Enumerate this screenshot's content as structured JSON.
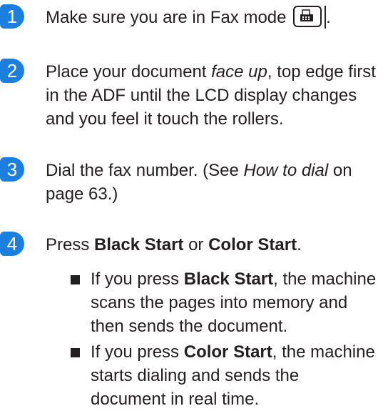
{
  "steps": [
    {
      "number": "1",
      "text_before": "Make sure you are in Fax mode",
      "text_after": "."
    },
    {
      "number": "2",
      "p1": "Place your document ",
      "p2_italic": "face up",
      "p3": ", top edge first in the ADF until the LCD display changes and you feel it touch the rollers."
    },
    {
      "number": "3",
      "p1": "Dial the fax number. (See ",
      "p2_italic": "How to dial",
      "p3": " on page 63.)"
    },
    {
      "number": "4",
      "p1": "Press ",
      "p2_bold": "Black Start",
      "p3": " or ",
      "p4_bold": "Color Start",
      "p5": ".",
      "bullets": [
        {
          "p1": "If you press ",
          "p2_bold": "Black Start",
          "p3": ", the machine scans the pages into memory and then sends the document."
        },
        {
          "p1": "If you press ",
          "p2_bold": "Color Start",
          "p3": ", the machine starts dialing and sends the document in real time."
        }
      ]
    }
  ],
  "icons": {
    "fax_mode_key": "fax-machine-icon",
    "step_marker": "numbered-circle",
    "bullet_marker": "black-square"
  },
  "colors": {
    "step_marker": "#1b7fe0",
    "text": "#231f20"
  }
}
